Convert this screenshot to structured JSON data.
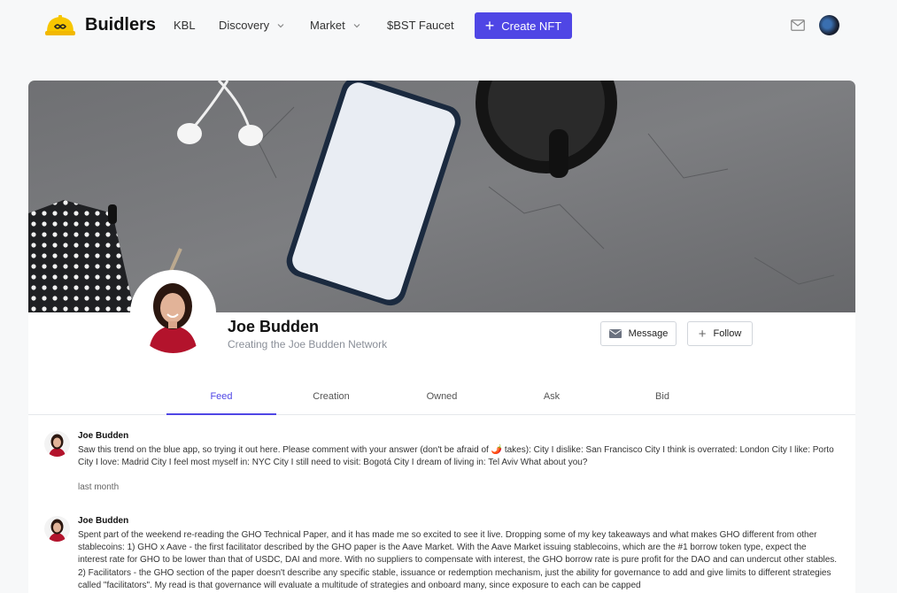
{
  "nav": {
    "brand": "Buidlers",
    "items": [
      {
        "label": "KBL"
      },
      {
        "label": "Discovery"
      },
      {
        "label": "Market"
      },
      {
        "label": "$BST Faucet"
      }
    ],
    "create_label": "Create NFT",
    "accent": "#4f46e5"
  },
  "profile": {
    "name": "Joe Budden",
    "tagline": "Creating the Joe Budden Network",
    "message_label": "Message",
    "follow_label": "Follow"
  },
  "tabs": [
    {
      "label": "Feed",
      "active": true
    },
    {
      "label": "Creation"
    },
    {
      "label": "Owned"
    },
    {
      "label": "Ask"
    },
    {
      "label": "Bid"
    }
  ],
  "posts": [
    {
      "author": "Joe Budden",
      "body": "Saw this trend on the blue app, so trying it out here. Please comment with your answer (don't be afraid of 🌶️ takes): City I dislike: San Francisco City I think is overrated: London City I like: Porto City I love: Madrid City I feel most myself in: NYC City I still need to visit: Bogotá City I dream of living in: Tel Aviv What about you?",
      "time": "last month"
    },
    {
      "author": "Joe Budden",
      "body": "Spent part of the weekend re-reading the GHO Technical Paper, and it has made me so excited to see it live. Dropping some of my key takeaways and what makes GHO different from other stablecoins: 1) GHO x Aave - the first facilitator described by the GHO paper is the Aave Market. With the Aave Market issuing stablecoins, which are the #1 borrow token type, expect the interest rate for GHO to be lower than that of USDC, DAI and more. With no suppliers to compensate with interest, the GHO borrow rate is pure profit for the DAO and can undercut other stables. 2) Facilitators - the GHO section of the paper doesn't describe any specific stable, issuance or redemption mechanism, just the ability for governance to add and give limits to different strategies called \"facilitators\". My read is that governance will evaluate a multitude of strategies and onboard many, since exposure to each can be capped"
    }
  ]
}
